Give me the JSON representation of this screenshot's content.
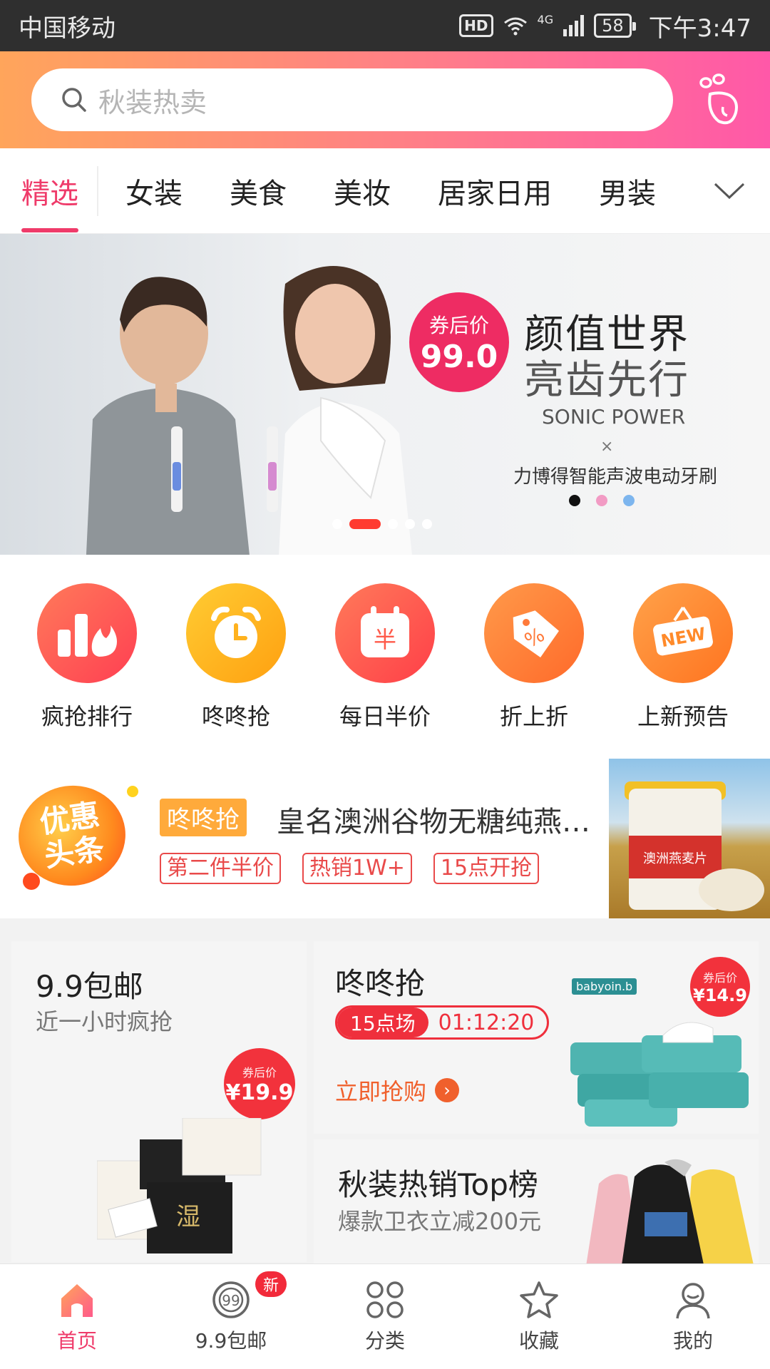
{
  "status_bar": {
    "carrier": "中国移动",
    "hd": "HD",
    "network": "4G",
    "battery": "58",
    "time": "下午3:47"
  },
  "search": {
    "placeholder": "秋装热卖"
  },
  "tabs": [
    "精选",
    "女装",
    "美食",
    "美妆",
    "居家日用",
    "男装"
  ],
  "banner": {
    "price_label": "券后价",
    "price_value": "99.0",
    "title_line1": "颜值世界",
    "title_line2": "亮齿先行",
    "tagline": "SONIC POWER",
    "times": "×",
    "brand_line": "力博得智能声波电动牙刷"
  },
  "quick_entries": [
    {
      "label": "疯抢排行",
      "icon": "hot-ranking-icon",
      "color": "#ff5f52"
    },
    {
      "label": "咚咚抢",
      "icon": "alarm-clock-icon",
      "color": "#ffb21e"
    },
    {
      "label": "每日半价",
      "icon": "calendar-yen-icon",
      "color": "#ff5a4a"
    },
    {
      "label": "折上折",
      "icon": "discount-tag-icon",
      "color": "#ff8a3a"
    },
    {
      "label": "上新预告",
      "icon": "new-sign-icon",
      "color": "#ff8a2a"
    }
  ],
  "news": {
    "badge_line1": "优惠",
    "badge_line2": "头条",
    "tag": "咚咚抢",
    "title": "皇名澳洲谷物无糖纯燕麦片",
    "chips": [
      "第二件半价",
      "热销1W+",
      "15点开抢"
    ],
    "product_label": "澳洲燕麦片"
  },
  "cards": {
    "left": {
      "title": "9.9包邮",
      "subtitle": "近一小时疯抢",
      "price_label": "券后价",
      "price": "¥19.9",
      "product_text": "湿"
    },
    "right_top": {
      "title": "咚咚抢",
      "session": "15点场",
      "countdown": "01:12:20",
      "cta": "立即抢购",
      "brand": "babyoin.b",
      "price_label": "券后价",
      "price": "¥14.9"
    },
    "right_bottom": {
      "title": "秋装热销Top榜",
      "subtitle": "爆款卫衣立减200元"
    }
  },
  "bottom_nav": [
    {
      "label": "首页",
      "icon": "home-icon"
    },
    {
      "label": "9.9包邮",
      "icon": "nine-nine-icon",
      "badge": "新"
    },
    {
      "label": "分类",
      "icon": "category-icon"
    },
    {
      "label": "收藏",
      "icon": "star-icon"
    },
    {
      "label": "我的",
      "icon": "profile-icon"
    }
  ],
  "colors": {
    "accent": "#ef3b6a",
    "header_start": "#ffa55b",
    "header_end": "#ff58a8",
    "price_red": "#f2323c"
  }
}
